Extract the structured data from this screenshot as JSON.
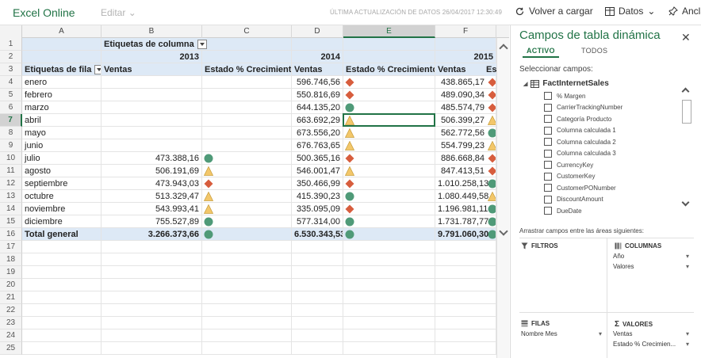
{
  "app": {
    "title": "Excel Online",
    "edit_menu": "Editar",
    "last_update": "ÚLTIMA ACTUALIZACIÓN DE DATOS 26/04/2017 12:30:49",
    "reload_label": "Volver a cargar",
    "data_label": "Datos",
    "anchor_label": "Ancla"
  },
  "columns": [
    "A",
    "B",
    "C",
    "D",
    "E",
    "F"
  ],
  "active_column": "E",
  "active_row": 7,
  "row_numbers": [
    1,
    2,
    3,
    4,
    5,
    6,
    7,
    8,
    9,
    10,
    11,
    12,
    13,
    14,
    15,
    16,
    17,
    18,
    19,
    20,
    21,
    22,
    23,
    24,
    25
  ],
  "pivot_table": {
    "col_labels_caption": "Etiquetas de columna",
    "row_labels_caption": "Etiquetas de fila",
    "years": [
      "2013",
      "2014",
      "2015"
    ],
    "sales_header": "Ventas",
    "growth_header": "Estado % Crecimiento",
    "truncated_header": "Es",
    "total_label": "Total general",
    "rows": [
      {
        "month": "enero",
        "v2013": "",
        "s2013": "",
        "v2014": "596.746,56",
        "s2014": "diamond-red",
        "v2015": "438.865,17",
        "s2015": "diamond-red"
      },
      {
        "month": "febrero",
        "v2013": "",
        "s2013": "",
        "v2014": "550.816,69",
        "s2014": "diamond-red",
        "v2015": "489.090,34",
        "s2015": "diamond-red"
      },
      {
        "month": "marzo",
        "v2013": "",
        "s2013": "",
        "v2014": "644.135,20",
        "s2014": "circle-green",
        "v2015": "485.574,79",
        "s2015": "diamond-red"
      },
      {
        "month": "abril",
        "v2013": "",
        "s2013": "",
        "v2014": "663.692,29",
        "s2014": "triangle-yellow",
        "v2015": "506.399,27",
        "s2015": "triangle-yellow"
      },
      {
        "month": "mayo",
        "v2013": "",
        "s2013": "",
        "v2014": "673.556,20",
        "s2014": "triangle-yellow",
        "v2015": "562.772,56",
        "s2015": "circle-green"
      },
      {
        "month": "junio",
        "v2013": "",
        "s2013": "",
        "v2014": "676.763,65",
        "s2014": "triangle-yellow",
        "v2015": "554.799,23",
        "s2015": "triangle-yellow"
      },
      {
        "month": "julio",
        "v2013": "473.388,16",
        "s2013": "circle-green",
        "v2014": "500.365,16",
        "s2014": "diamond-red",
        "v2015": "886.668,84",
        "s2015": "diamond-red"
      },
      {
        "month": "agosto",
        "v2013": "506.191,69",
        "s2013": "triangle-yellow",
        "v2014": "546.001,47",
        "s2014": "triangle-yellow",
        "v2015": "847.413,51",
        "s2015": "diamond-red"
      },
      {
        "month": "septiembre",
        "v2013": "473.943,03",
        "s2013": "diamond-red",
        "v2014": "350.466,99",
        "s2014": "diamond-red",
        "v2015": "1.010.258,13",
        "s2015": "circle-green"
      },
      {
        "month": "octubre",
        "v2013": "513.329,47",
        "s2013": "triangle-yellow",
        "v2014": "415.390,23",
        "s2014": "circle-green",
        "v2015": "1.080.449,58",
        "s2015": "triangle-yellow"
      },
      {
        "month": "noviembre",
        "v2013": "543.993,41",
        "s2013": "triangle-yellow",
        "v2014": "335.095,09",
        "s2014": "diamond-red",
        "v2015": "1.196.981,11",
        "s2015": "circle-green"
      },
      {
        "month": "diciembre",
        "v2013": "755.527,89",
        "s2013": "circle-green",
        "v2014": "577.314,00",
        "s2014": "circle-green",
        "v2015": "1.731.787,77",
        "s2015": "circle-green"
      }
    ],
    "totals": {
      "v2013": "3.266.373,66",
      "s2013": "circle-green",
      "v2014": "6.530.343,53",
      "s2014": "circle-green",
      "v2015": "9.791.060,30",
      "s2015": "circle-green"
    }
  },
  "pivot_pane": {
    "title": "Campos de tabla dinámica",
    "tab_active": "ACTIVO",
    "tab_all": "TODOS",
    "select_fields": "Seleccionar campos:",
    "table_name": "FactInternetSales",
    "fields": [
      "% Margen",
      "CarrierTrackingNumber",
      "Categoría Producto",
      "Columna calculada 1",
      "Columna calculada 2",
      "Columna calculada 3",
      "CurrencyKey",
      "CustomerKey",
      "CustomerPONumber",
      "DiscountAmount",
      "DueDate"
    ],
    "drag_hint": "Arrastrar campos entre las áreas siguientes:",
    "filters_label": "FILTROS",
    "columns_label": "COLUMNAS",
    "columns_items": [
      "Año",
      "Valores"
    ],
    "rows_label": "FILAS",
    "rows_items": [
      "Nombre Mes"
    ],
    "values_label": "VALORES",
    "values_items": [
      "Ventas",
      "Estado % Crecimien..."
    ]
  },
  "colors": {
    "brand": "#217346",
    "header_fill": "#dde9f6",
    "status_green": "#4f9a78",
    "status_yellow": "#f3c76a",
    "status_red": "#d75d3d"
  }
}
